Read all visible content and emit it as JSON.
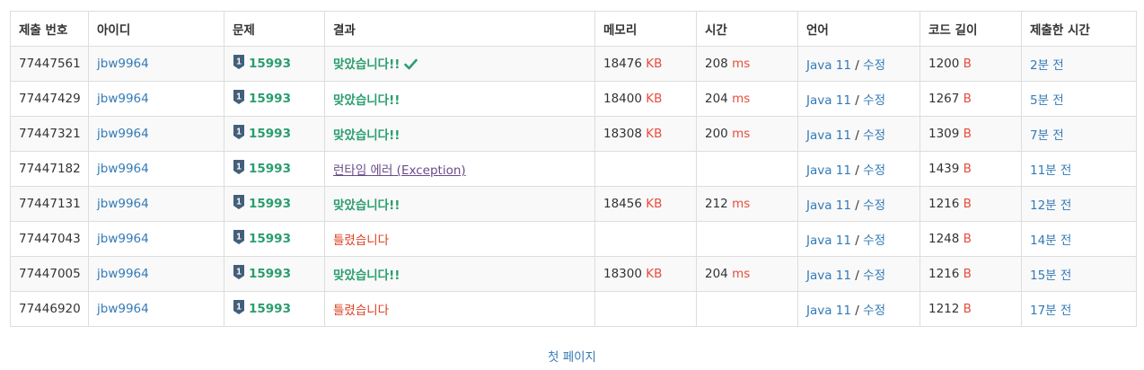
{
  "columns": [
    "제출 번호",
    "아이디",
    "문제",
    "결과",
    "메모리",
    "시간",
    "언어",
    "코드 길이",
    "제출한 시간"
  ],
  "units": {
    "memory": "KB",
    "time": "ms",
    "length": "B"
  },
  "language_edit_separator": "/",
  "colors": {
    "accepted": "#2a9d6f",
    "wrong": "#dd4124",
    "runtime_error": "#6b4a8a",
    "link": "#337ab7",
    "unit": "#e74c3c",
    "tier_badge": "#435f7a"
  },
  "rows": [
    {
      "id": "77447561",
      "user": "jbw9964",
      "problem": "15993",
      "tier": "1",
      "result": "맞았습니다!!",
      "result_type": "ac",
      "checkmark": true,
      "memory": "18476",
      "time": "208",
      "lang": "Java 11",
      "edit": "수정",
      "length": "1200",
      "ago": "2분 전"
    },
    {
      "id": "77447429",
      "user": "jbw9964",
      "problem": "15993",
      "tier": "1",
      "result": "맞았습니다!!",
      "result_type": "ac",
      "checkmark": false,
      "memory": "18400",
      "time": "204",
      "lang": "Java 11",
      "edit": "수정",
      "length": "1267",
      "ago": "5분 전"
    },
    {
      "id": "77447321",
      "user": "jbw9964",
      "problem": "15993",
      "tier": "1",
      "result": "맞았습니다!!",
      "result_type": "ac",
      "checkmark": false,
      "memory": "18308",
      "time": "200",
      "lang": "Java 11",
      "edit": "수정",
      "length": "1309",
      "ago": "7분 전"
    },
    {
      "id": "77447182",
      "user": "jbw9964",
      "problem": "15993",
      "tier": "1",
      "result": "런타임 에러 (Exception)",
      "result_type": "rte",
      "checkmark": false,
      "memory": "",
      "time": "",
      "lang": "Java 11",
      "edit": "수정",
      "length": "1439",
      "ago": "11분 전"
    },
    {
      "id": "77447131",
      "user": "jbw9964",
      "problem": "15993",
      "tier": "1",
      "result": "맞았습니다!!",
      "result_type": "ac",
      "checkmark": false,
      "memory": "18456",
      "time": "212",
      "lang": "Java 11",
      "edit": "수정",
      "length": "1216",
      "ago": "12분 전"
    },
    {
      "id": "77447043",
      "user": "jbw9964",
      "problem": "15993",
      "tier": "1",
      "result": "틀렸습니다",
      "result_type": "wa",
      "checkmark": false,
      "memory": "",
      "time": "",
      "lang": "Java 11",
      "edit": "수정",
      "length": "1248",
      "ago": "14분 전"
    },
    {
      "id": "77447005",
      "user": "jbw9964",
      "problem": "15993",
      "tier": "1",
      "result": "맞았습니다!!",
      "result_type": "ac",
      "checkmark": false,
      "memory": "18300",
      "time": "204",
      "lang": "Java 11",
      "edit": "수정",
      "length": "1216",
      "ago": "15분 전"
    },
    {
      "id": "77446920",
      "user": "jbw9964",
      "problem": "15993",
      "tier": "1",
      "result": "틀렸습니다",
      "result_type": "wa",
      "checkmark": false,
      "memory": "",
      "time": "",
      "lang": "Java 11",
      "edit": "수정",
      "length": "1212",
      "ago": "17분 전"
    }
  ],
  "pagination": {
    "first_page": "첫 페이지"
  }
}
